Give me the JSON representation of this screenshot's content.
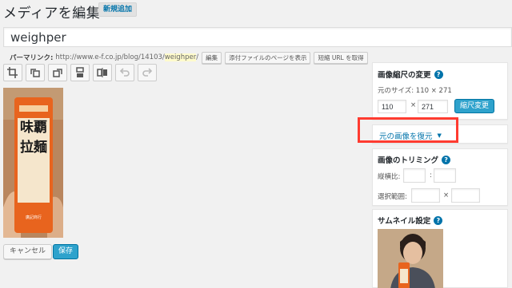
{
  "header": {
    "title": "メディアを編集",
    "add_new": "新規追加"
  },
  "title_field": {
    "value": "weighper"
  },
  "permalink": {
    "label": "パーマリンク:",
    "base_url": "http://www.e-f.co.jp/blog/14103/",
    "slug": "weighper",
    "trailing": "/",
    "edit_button": "編集",
    "attachment_page_button": "添付ファイルのページを表示",
    "shortlink_button": "短縮 URL を取得"
  },
  "toolbar": {
    "icons": [
      "crop-icon",
      "rotate-left-icon",
      "rotate-right-icon",
      "flip-vertical-icon",
      "flip-horizontal-icon",
      "undo-icon",
      "redo-icon"
    ]
  },
  "image": {
    "package_text": "味覇拉麺"
  },
  "buttons": {
    "cancel": "キャンセル",
    "save": "保存"
  },
  "scale_panel": {
    "title": "画像縮尺の変更",
    "original_size_label": "元のサイズ: 110 × 271",
    "width_value": "110",
    "times": "×",
    "height_value": "271",
    "scale_button": "縮尺変更"
  },
  "restore_panel": {
    "link": "元の画像を復元",
    "arrow": "▼"
  },
  "crop_panel": {
    "title": "画像のトリミング",
    "ratio_label": "縦横比:",
    "ratio_sep": ":",
    "selection_label": "選択範囲:",
    "selection_sep": "×"
  },
  "thumb_panel": {
    "title": "サムネイル設定"
  },
  "colors": {
    "accent": "#2ea2cc",
    "link": "#0073aa",
    "highlight": "#ff3b30",
    "package_orange": "#e8641e"
  }
}
